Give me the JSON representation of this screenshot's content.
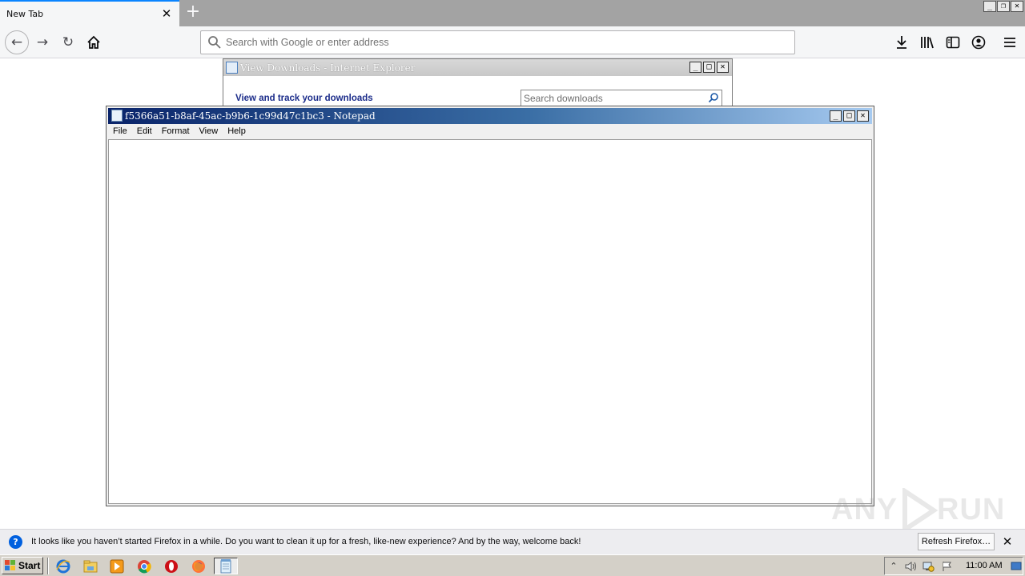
{
  "browser": {
    "tab_title": "New Tab",
    "address_placeholder": "Search with Google or enter address",
    "icons": [
      "back-icon",
      "forward-icon",
      "reload-icon",
      "home-icon",
      "downloads-icon",
      "library-icon",
      "sidebar-icon",
      "account-icon",
      "menu-icon",
      "search-icon",
      "close-icon",
      "plus-icon"
    ]
  },
  "ie_window": {
    "title": "View Downloads - Internet Explorer",
    "heading": "View and track your downloads",
    "search_placeholder": "Search downloads"
  },
  "notepad": {
    "title": "f5366a51-b8af-45ac-b9b6-1c99d47c1bc3 - Notepad",
    "menus": [
      "File",
      "Edit",
      "Format",
      "View",
      "Help"
    ],
    "content": ""
  },
  "notification": {
    "text": "It looks like you haven’t started Firefox in a while. Do you want to clean it up for a fresh, like-new experience? And by the way, welcome back!",
    "button": "Refresh Firefox…"
  },
  "taskbar": {
    "start_label": "Start",
    "clock": "11:00 AM",
    "apps": [
      "internet-explorer",
      "file-explorer",
      "media-player",
      "chrome",
      "opera",
      "firefox",
      "notepad"
    ]
  },
  "watermark": {
    "text_left": "ANY",
    "text_right": "RUN"
  },
  "colors": {
    "accent": "#0a84ff",
    "notepad_title_start": "#0a246a",
    "notepad_title_end": "#a6caf0",
    "ie_heading": "#1b2c8a"
  }
}
